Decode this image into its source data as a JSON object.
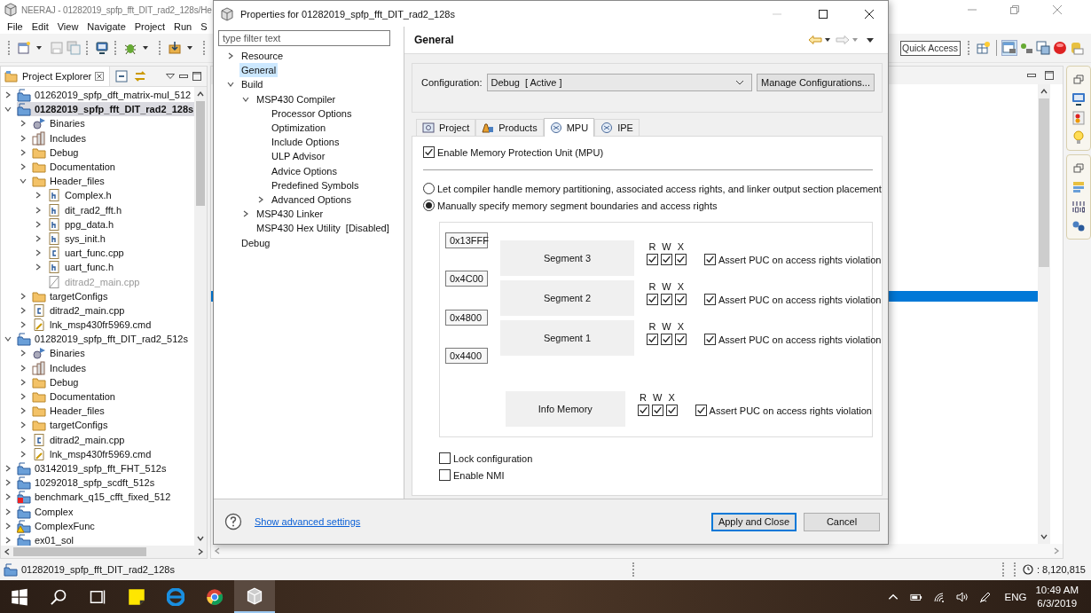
{
  "ide": {
    "title": "NEERAJ - 01282019_spfp_fft_DIT_rad2_128s/He",
    "menu": [
      "File",
      "Edit",
      "View",
      "Navigate",
      "Project",
      "Run",
      "S"
    ],
    "quick_access": {
      "placeholder": "Quick Access"
    }
  },
  "explorer": {
    "tab": "Project Explorer",
    "tree": [
      {
        "label": "01262019_spfp_dft_matrix-mul_512",
        "kind": "project",
        "expanded": false,
        "selected": false
      },
      {
        "label": "01282019_spfp_fft_DIT_rad2_128s",
        "kind": "project",
        "expanded": true,
        "selected": true,
        "children": [
          {
            "label": "Binaries",
            "kind": "binaries",
            "expanded": false,
            "selected": false
          },
          {
            "label": "Includes",
            "kind": "includes",
            "expanded": false,
            "selected": false
          },
          {
            "label": "Debug",
            "kind": "folder",
            "expanded": false,
            "selected": false
          },
          {
            "label": "Documentation",
            "kind": "folder",
            "expanded": false,
            "selected": false
          },
          {
            "label": "Header_files",
            "kind": "folder",
            "expanded": true,
            "selected": false,
            "children": [
              {
                "label": "Complex.h",
                "kind": "header",
                "expanded": false,
                "selected": false
              },
              {
                "label": "dit_rad2_fft.h",
                "kind": "header",
                "expanded": false,
                "selected": false
              },
              {
                "label": "ppg_data.h",
                "kind": "header",
                "expanded": false,
                "selected": false
              },
              {
                "label": "sys_init.h",
                "kind": "header",
                "expanded": false,
                "selected": false
              },
              {
                "label": "uart_func.cpp",
                "kind": "source",
                "expanded": false,
                "selected": false
              },
              {
                "label": "uart_func.h",
                "kind": "header",
                "expanded": false,
                "selected": false
              },
              {
                "label": "ditrad2_main.cpp",
                "kind": "excluded",
                "selected": false
              }
            ]
          },
          {
            "label": "targetConfigs",
            "kind": "folder",
            "expanded": false,
            "selected": false
          },
          {
            "label": "ditrad2_main.cpp",
            "kind": "source",
            "expanded": false,
            "selected": false
          },
          {
            "label": "lnk_msp430fr5969.cmd",
            "kind": "linker",
            "expanded": false,
            "selected": false
          }
        ]
      },
      {
        "label": "01282019_spfp_fft_DIT_rad2_512s",
        "kind": "project",
        "expanded": true,
        "selected": false,
        "children": [
          {
            "label": "Binaries",
            "kind": "binaries",
            "expanded": false,
            "selected": false
          },
          {
            "label": "Includes",
            "kind": "includes",
            "expanded": false,
            "selected": false
          },
          {
            "label": "Debug",
            "kind": "folder",
            "expanded": false,
            "selected": false
          },
          {
            "label": "Documentation",
            "kind": "folder",
            "expanded": false,
            "selected": false
          },
          {
            "label": "Header_files",
            "kind": "folder",
            "expanded": false,
            "selected": false
          },
          {
            "label": "targetConfigs",
            "kind": "folder",
            "expanded": false,
            "selected": false
          },
          {
            "label": "ditrad2_main.cpp",
            "kind": "source",
            "expanded": false,
            "selected": false
          },
          {
            "label": "lnk_msp430fr5969.cmd",
            "kind": "linker",
            "expanded": false,
            "selected": false
          }
        ]
      },
      {
        "label": "03142019_spfp_fft_FHT_512s",
        "kind": "project",
        "expanded": false,
        "selected": false
      },
      {
        "label": "10292018_spfp_scdft_512s",
        "kind": "project",
        "expanded": false,
        "selected": false
      },
      {
        "label": "benchmark_q15_cfft_fixed_512",
        "kind": "project-error",
        "expanded": false,
        "selected": false
      },
      {
        "label": "Complex",
        "kind": "project",
        "expanded": false,
        "selected": false
      },
      {
        "label": "ComplexFunc",
        "kind": "project-warning",
        "expanded": false,
        "selected": false
      },
      {
        "label": "ex01_sol",
        "kind": "project",
        "expanded": false,
        "selected": false
      }
    ]
  },
  "dialog": {
    "title": "Properties for 01282019_spfp_fft_DIT_rad2_128s",
    "filter": {
      "placeholder": "type filter text"
    },
    "tree": [
      {
        "label": "Resource",
        "expanded": false,
        "selected": false
      },
      {
        "label": "General",
        "selected": true
      },
      {
        "label": "Build",
        "expanded": true,
        "selected": false,
        "children": [
          {
            "label": "MSP430 Compiler",
            "expanded": true,
            "selected": false,
            "children": [
              {
                "label": "Processor Options",
                "selected": false
              },
              {
                "label": "Optimization",
                "selected": false
              },
              {
                "label": "Include Options",
                "selected": false
              },
              {
                "label": "ULP Advisor",
                "selected": false
              },
              {
                "label": "Advice Options",
                "selected": false
              },
              {
                "label": "Predefined Symbols",
                "selected": false
              },
              {
                "label": "Advanced Options",
                "expanded": false,
                "selected": false
              }
            ]
          },
          {
            "label": "MSP430 Linker",
            "expanded": false,
            "selected": false
          },
          {
            "label": "MSP430 Hex Utility  [Disabled]",
            "selected": false
          }
        ]
      },
      {
        "label": "Debug",
        "selected": false
      }
    ],
    "page_title": "General",
    "configuration": {
      "label": "Configuration:",
      "value": "Debug  [ Active ]",
      "button": "Manage Configurations..."
    },
    "tabs": [
      {
        "label": "Project",
        "kind": "project",
        "selected": false
      },
      {
        "label": "Products",
        "kind": "products",
        "selected": false
      },
      {
        "label": "MPU",
        "kind": "chip",
        "selected": true
      },
      {
        "label": "IPE",
        "kind": "chip",
        "selected": false
      }
    ],
    "mpu": {
      "enable": {
        "label": "Enable Memory Protection Unit (MPU)",
        "checked": true
      },
      "modes": [
        {
          "label": "Let compiler handle memory partitioning, associated access rights, and linker output section placement",
          "selected": false
        },
        {
          "label": "Manually specify memory segment boundaries and access rights",
          "selected": true
        }
      ],
      "boundaries": [
        "0x13FFF",
        "0x4C00",
        "0x4800",
        "0x4400"
      ],
      "segments": [
        {
          "name": "Segment 3",
          "rights": [
            {
              "label": "R",
              "checked": true
            },
            {
              "label": "W",
              "checked": true
            },
            {
              "label": "X",
              "checked": true
            }
          ],
          "assert": {
            "label": "Assert PUC on access rights violation",
            "checked": true
          }
        },
        {
          "name": "Segment 2",
          "rights": [
            {
              "label": "R",
              "checked": true
            },
            {
              "label": "W",
              "checked": true
            },
            {
              "label": "X",
              "checked": true
            }
          ],
          "assert": {
            "label": "Assert PUC on access rights violation",
            "checked": true
          }
        },
        {
          "name": "Segment 1",
          "rights": [
            {
              "label": "R",
              "checked": true
            },
            {
              "label": "W",
              "checked": true
            },
            {
              "label": "X",
              "checked": true
            }
          ],
          "assert": {
            "label": "Assert PUC on access rights violation",
            "checked": true
          }
        }
      ],
      "info_memory": {
        "name": "Info Memory",
        "rights": [
          {
            "label": "R",
            "checked": true
          },
          {
            "label": "W",
            "checked": true
          },
          {
            "label": "X",
            "checked": true
          }
        ],
        "assert": {
          "label": "Assert PUC on access rights violation",
          "checked": true
        }
      },
      "options": [
        {
          "label": "Lock configuration",
          "checked": false
        },
        {
          "label": "Enable NMI",
          "checked": false
        }
      ]
    },
    "help_link": "Show advanced settings",
    "buttons": [
      {
        "label": "Apply and Close",
        "default": true
      },
      {
        "label": "Cancel",
        "default": false
      }
    ]
  },
  "status_bar": {
    "selection": "01282019_spfp_fft_DIT_rad2_128s",
    "heap": ": 8,120,815"
  },
  "taskbar": {
    "language": "ENG",
    "time": "10:49 AM",
    "date": "6/3/2019"
  }
}
